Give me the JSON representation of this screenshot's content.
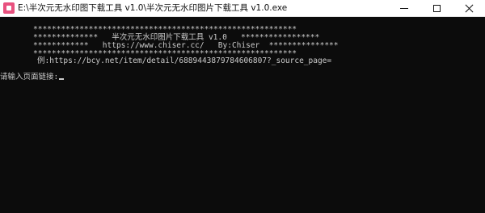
{
  "window": {
    "title": "E:\\半次元无水印图下载工具 v1.0\\半次元无水印图片下载工具 v1.0.exe"
  },
  "controls": {
    "minimize_icon": "minimize-icon",
    "maximize_icon": "maximize-icon",
    "close_icon": "close-icon"
  },
  "console": {
    "banner_border_top": "*********************************************************",
    "banner_title": "**************   半次元无水印图片下载工具 v1.0   *****************",
    "banner_credits": "************   https://www.chiser.cc/   By:Chiser  ***************",
    "banner_border_bottom": "*********************************************************",
    "example_line": "例:https://bcy.net/item/detail/6889443879784606807?_source_page=",
    "prompt": "请输入页面链接:"
  },
  "colors": {
    "console_background": "#0c0c0c",
    "console_text": "#cccccc",
    "titlebar_background": "#ffffff",
    "app_icon_accent": "#e8517f"
  }
}
